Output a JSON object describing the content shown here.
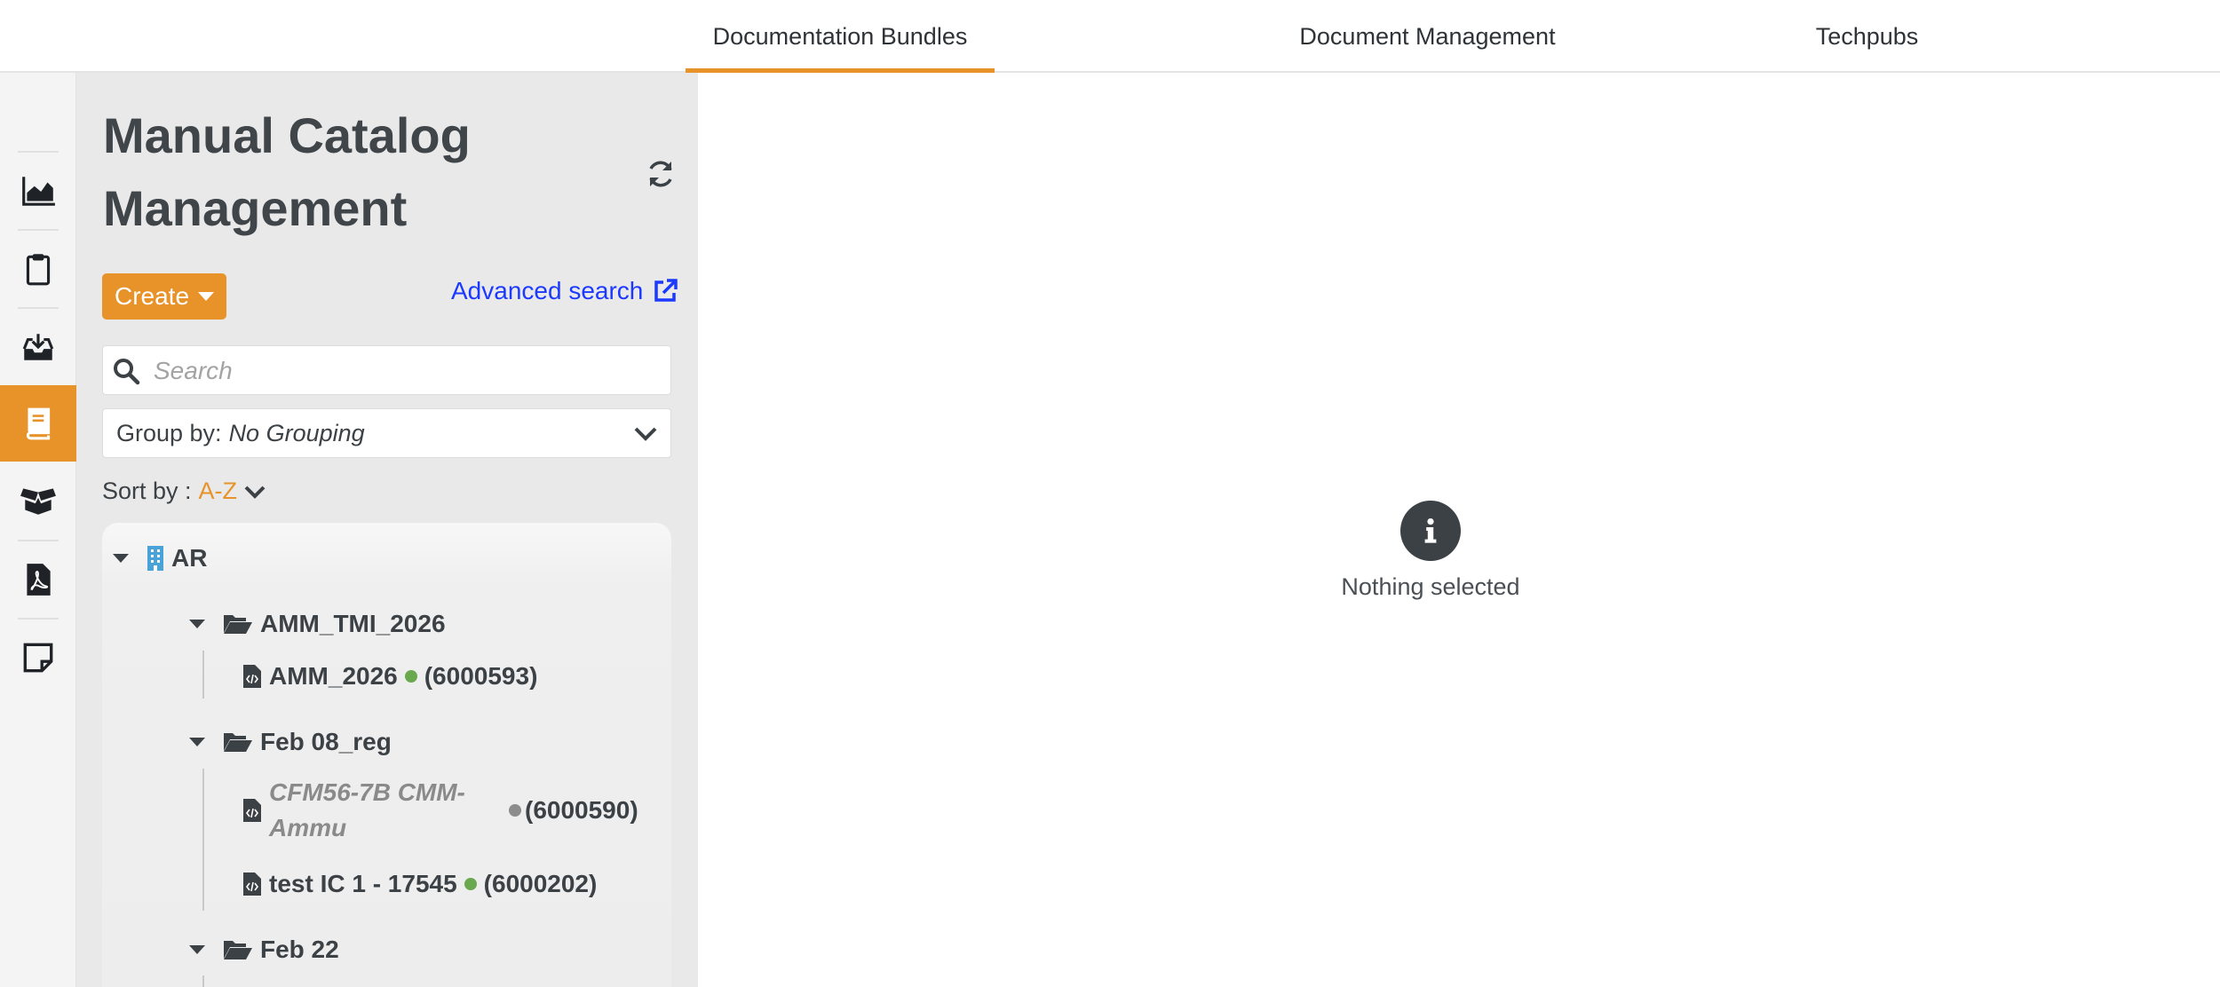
{
  "tabs": [
    {
      "label": "Documentation Bundles",
      "active": true
    },
    {
      "label": "Document Management",
      "active": false
    },
    {
      "label": "Techpubs",
      "active": false
    }
  ],
  "rail": [
    {
      "icon": "chart-area-icon",
      "active": false
    },
    {
      "icon": "clipboard-icon",
      "active": false
    },
    {
      "icon": "inbox-download-icon",
      "active": false
    },
    {
      "icon": "book-icon",
      "active": true
    },
    {
      "icon": "open-box-icon",
      "active": false
    },
    {
      "icon": "file-pdf-icon",
      "active": false
    },
    {
      "icon": "sticky-note-icon",
      "active": false
    }
  ],
  "panel": {
    "title_line1": "Manual Catalog",
    "title_line2": "Management",
    "create_label": "Create",
    "advanced_search_label": "Advanced search",
    "search_placeholder": "Search",
    "group_by_label": "Group by:",
    "group_by_value": "No Grouping",
    "sort_by_label": "Sort by :",
    "sort_by_value": "A-Z"
  },
  "tree": {
    "root": "AR",
    "groups": [
      {
        "name": "AMM_TMI_2026",
        "items": [
          {
            "name": "AMM_2026",
            "status": "green",
            "code": "(6000593)",
            "italic": false
          }
        ]
      },
      {
        "name": "Feb 08_reg",
        "items": [
          {
            "name_line1": "CFM56-7B CMM-",
            "name_line2": "Ammu",
            "status": "grey",
            "code": "(6000590)",
            "italic": true
          },
          {
            "name": "test IC 1 - 17545",
            "status": "green",
            "code": "(6000202)",
            "italic": false
          }
        ]
      },
      {
        "name": "Feb 22",
        "items": []
      }
    ]
  },
  "main": {
    "empty_text": "Nothing selected"
  },
  "colors": {
    "accent": "#e8922a",
    "link": "#1b39ff",
    "status_green": "#6aa84f",
    "status_grey": "#8c8c8c"
  }
}
